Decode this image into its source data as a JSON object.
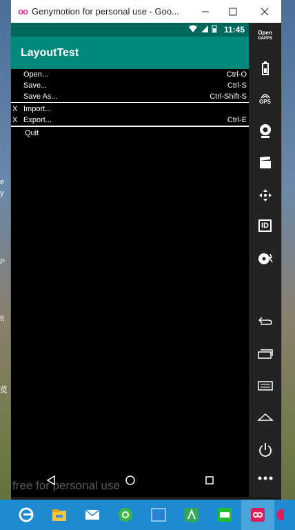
{
  "window": {
    "title": "Genymotion for personal use - Goo...",
    "logo": "oo"
  },
  "status": {
    "time": "11:45"
  },
  "app": {
    "title": "LayoutTest"
  },
  "menu": [
    {
      "check": "",
      "label": "Open...",
      "shortcut": "Ctrl-O"
    },
    {
      "check": "",
      "label": "Save...",
      "shortcut": "Ctrl-S"
    },
    {
      "check": "",
      "label": "Save As...",
      "shortcut": "Ctrl-Shift-S"
    },
    {
      "check": "X",
      "label": "Import...",
      "shortcut": ""
    },
    {
      "check": "X",
      "label": "Export...",
      "shortcut": "Ctrl-E"
    },
    {
      "check": "",
      "label": "Quit",
      "shortcut": ""
    }
  ],
  "watermark": "free for personal use",
  "sidebar": {
    "opengapps": [
      "Open",
      "GAPPS"
    ],
    "gps": "GPS",
    "id": "ID"
  },
  "desktop": {
    "labels": [
      "e",
      "y",
      "P",
      "ft",
      "览"
    ]
  }
}
